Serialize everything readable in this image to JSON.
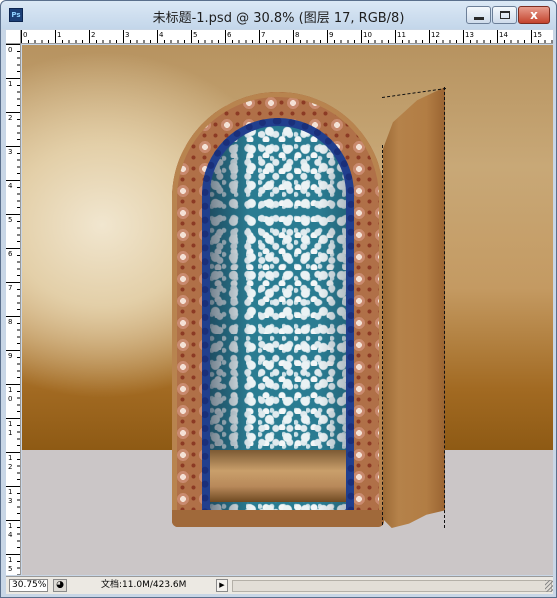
{
  "window": {
    "title": "未标题-1.psd @ 30.8% (图层 17, RGB/8)",
    "app_icon_label": "Ps",
    "app_icon": "photoshop-icon",
    "controls": {
      "minimize": "minimize-icon",
      "maximize": "maximize-icon",
      "close_glyph": "x",
      "close": "close-icon"
    }
  },
  "ruler": {
    "horizontal_labels": [
      "0",
      "1",
      "2",
      "3",
      "4",
      "5",
      "6",
      "7",
      "8",
      "9",
      "10",
      "11",
      "12",
      "13",
      "14",
      "15"
    ],
    "vertical_labels": [
      "0",
      "1",
      "2",
      "3",
      "4",
      "5",
      "6",
      "7",
      "8",
      "9",
      "1",
      "1",
      "1",
      "1",
      "1",
      "1"
    ],
    "vertical_label_suffixes": [
      "",
      "",
      "",
      "",
      "",
      "",
      "",
      "",
      "",
      "",
      "0",
      "1",
      "2",
      "3",
      "4",
      "5"
    ]
  },
  "canvas": {
    "scene": "arched cabinet with patterned frame, floral back panel, blue jeweled trim and open door",
    "colors": {
      "wall_light": "#f1e6cf",
      "wall_dark": "#8e5a14",
      "floor": "#cbc6c7",
      "cabinet_frame": "#b07048",
      "jewel_trim": "#213f8e",
      "back_panel": "#2a7c92",
      "door": "#b5824a"
    }
  },
  "status": {
    "zoom": "30.75%",
    "info_icon": "status-info-icon",
    "doc_info": "文档:11.0M/423.6M",
    "arrow": "▶"
  }
}
